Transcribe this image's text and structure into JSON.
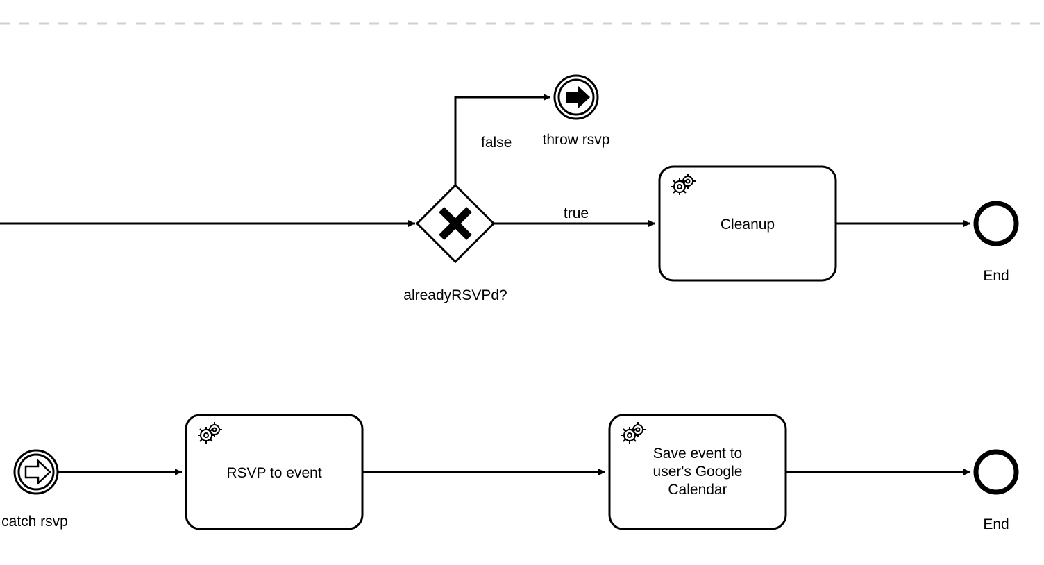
{
  "diagram": {
    "gateway": {
      "label": "alreadyRSVPd?",
      "falseLabel": "false",
      "trueLabel": "true"
    },
    "throwEvent": {
      "label": "throw rsvp"
    },
    "cleanupTask": {
      "label": "Cleanup"
    },
    "end1": {
      "label": "End"
    },
    "catchEvent": {
      "label": "catch rsvp"
    },
    "rsvpTask": {
      "label": "RSVP to event"
    },
    "saveTask": {
      "label": "Save event to user's Google Calendar"
    },
    "end2": {
      "label": "End"
    }
  }
}
